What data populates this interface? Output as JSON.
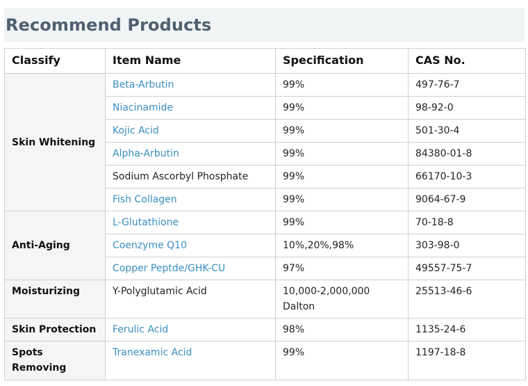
{
  "page": {
    "title": "Recommend Products"
  },
  "table": {
    "headers": [
      "Classify",
      "Item Name",
      "Specification",
      "CAS No."
    ],
    "categories": {
      "whitening": "Skin Whitening",
      "antiaging": "Anti-Aging",
      "moisturizing": "Moisturizing",
      "protection": "Skin Protection",
      "spots": "Spots Removing"
    },
    "rows": [
      {
        "name": "Beta-Arbutin",
        "spec": "99%",
        "cas": "497-76-7",
        "link": true
      },
      {
        "name": "Niacinamide",
        "spec": "99%",
        "cas": "98-92-0",
        "link": true
      },
      {
        "name": "Kojic Acid",
        "spec": "99%",
        "cas": "501-30-4",
        "link": true
      },
      {
        "name": "Alpha-Arbutin",
        "spec": "99%",
        "cas": "84380-01-8",
        "link": true
      },
      {
        "name": "Sodium Ascorbyl Phosphate",
        "spec": "99%",
        "cas": "66170-10-3",
        "link": false
      },
      {
        "name": "Fish Collagen",
        "spec": "99%",
        "cas": "9064-67-9",
        "link": true
      },
      {
        "name": "L-Glutathione",
        "spec": "99%",
        "cas": "70-18-8",
        "link": true
      },
      {
        "name": "Coenzyme Q10",
        "spec": "10%,20%,98%",
        "cas": "303-98-0",
        "link": true
      },
      {
        "name": "Copper Peptde/GHK-CU",
        "spec": "97%",
        "cas": "49557-75-7",
        "link": true
      },
      {
        "name": "Y-Polyglutamic Acid",
        "spec": "10,000-2,000,000 Dalton",
        "cas": "25513-46-6",
        "link": false
      },
      {
        "name": "Ferulic Acid",
        "spec": "98%",
        "cas": "1135-24-6",
        "link": true
      },
      {
        "name": "Tranexamic Acid",
        "spec": "99%",
        "cas": "1197-18-8",
        "link": true
      }
    ],
    "colors": {
      "link": "#3a8ec2",
      "title": "#506070",
      "title_bg": "#f1f4f5",
      "category_bg": "#f4f5f7",
      "border": "#cfcfcf"
    }
  }
}
